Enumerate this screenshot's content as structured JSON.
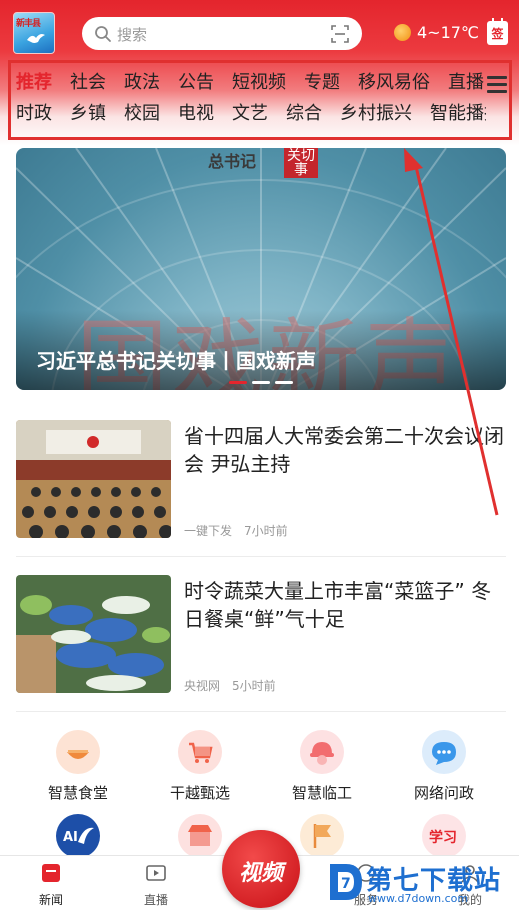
{
  "header": {
    "search_placeholder": "搜索",
    "weather": "4~17℃",
    "sign_label": "签",
    "logo_text": "新丰县"
  },
  "tabs": {
    "row1": [
      "推荐",
      "社会",
      "政法",
      "公告",
      "短视频",
      "专题",
      "移风易俗",
      "直播"
    ],
    "row2": [
      "时政",
      "乡镇",
      "校园",
      "电视",
      "文艺",
      "综合",
      "乡村振兴",
      "智能播报"
    ],
    "active": "推荐"
  },
  "banner": {
    "title": "习近平总书记关切事丨国戏新声",
    "art_text": "国戏新声",
    "tag_text": "总书记",
    "tag_stamp": "关切事"
  },
  "news": [
    {
      "headline": "省十四届人大常委会第二十次会议闭会 尹弘主持",
      "source": "一键下发",
      "time": "7小时前"
    },
    {
      "headline": "时令蔬菜大量上市丰富“菜篮子” 冬日餐桌“鲜”气十足",
      "source": "央视网",
      "time": "5小时前"
    }
  ],
  "services": [
    {
      "label": "智慧食堂",
      "icon": "canteen-icon"
    },
    {
      "label": "干越甄选",
      "icon": "shopping-cart-icon"
    },
    {
      "label": "智慧临工",
      "icon": "worker-helmet-icon"
    },
    {
      "label": "网络问政",
      "icon": "chat-bubble-icon"
    }
  ],
  "services_row2": [
    {
      "icon": "ai-assistant-icon"
    },
    {
      "icon": "store-icon"
    },
    {
      "icon": "flag-icon"
    },
    {
      "icon": "study-icon",
      "text": "学习"
    }
  ],
  "bottom_nav": {
    "news": "新闻",
    "live": "直播",
    "video": "视频",
    "service": "服务",
    "mine": "我的"
  },
  "watermark": {
    "text": "第七下载站",
    "url": "www.d7down.com"
  },
  "colors": {
    "brand_red": "#e4252d",
    "watermark_blue": "#1e6fd0"
  }
}
